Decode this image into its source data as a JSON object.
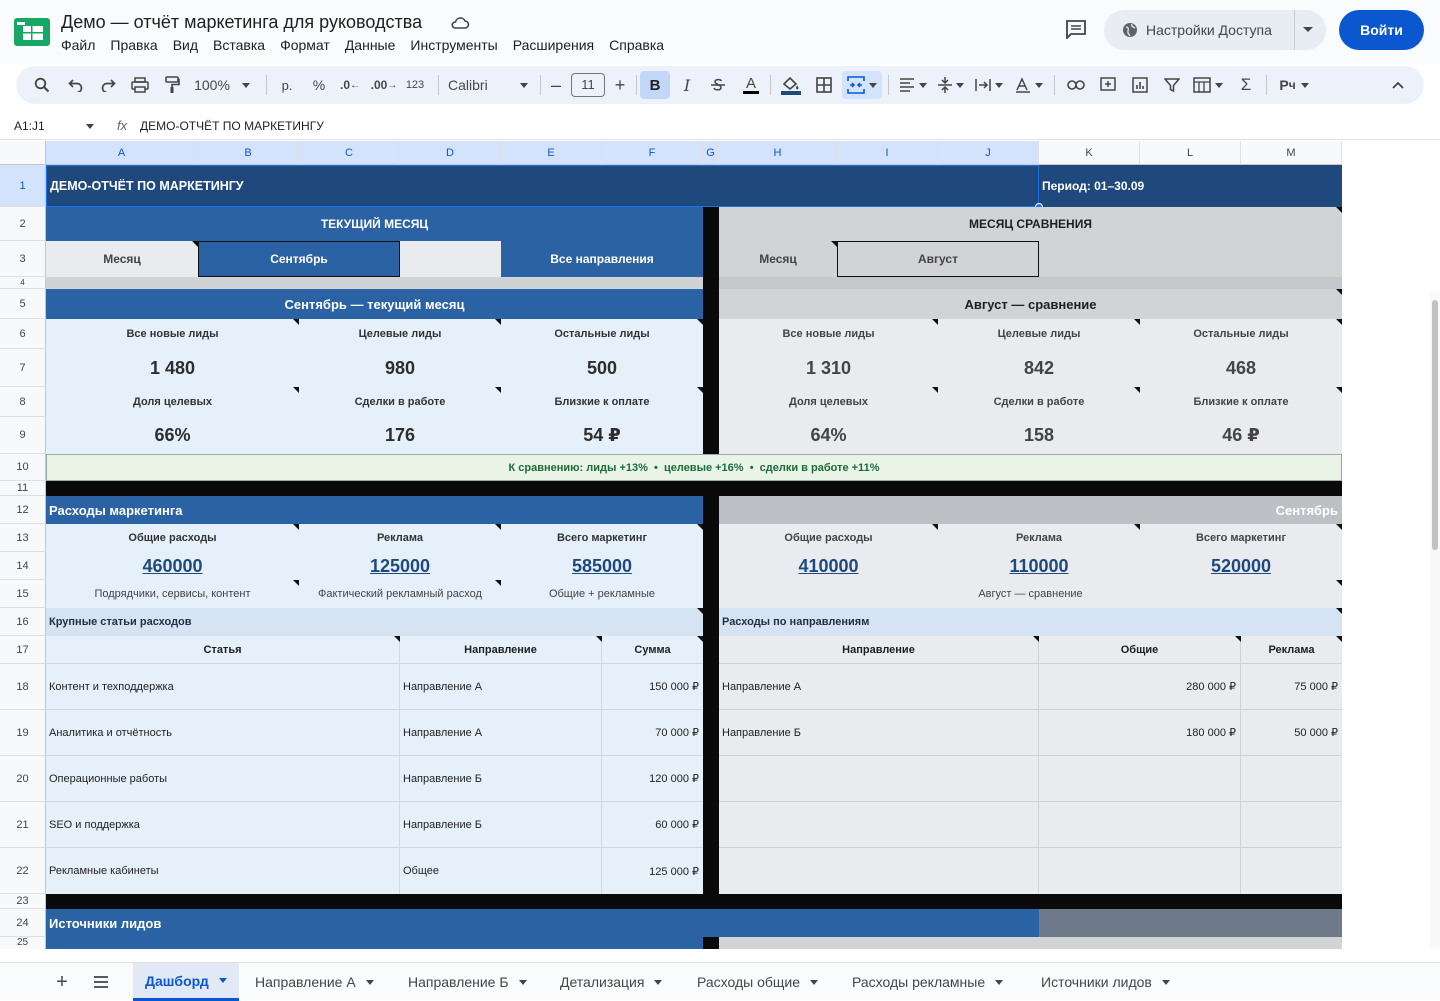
{
  "app": {
    "doc_title": "Демо — отчёт маркетинга для руководства",
    "menu": [
      "Файл",
      "Правка",
      "Вид",
      "Вставка",
      "Формат",
      "Данные",
      "Инструменты",
      "Расширения",
      "Справка"
    ],
    "access_label": "Настройки Доступа",
    "login_label": "Войти"
  },
  "toolbar": {
    "zoom": "100%",
    "currency": "р.",
    "percent": "%",
    "dec_less": ".0",
    "dec_more": ".00",
    "num_format": "123",
    "font": "Calibri",
    "font_size": "11",
    "bold": "B",
    "italic": "I",
    "text_color": "A"
  },
  "formula_bar": {
    "name_box": "A1:J1",
    "fx": "fx",
    "content": "ДЕМО-ОТЧЁТ ПО МАРКЕТИНГУ"
  },
  "columns": [
    "A",
    "B",
    "C",
    "D",
    "E",
    "F",
    "G",
    "H",
    "I",
    "J",
    "K",
    "L",
    "M"
  ],
  "rows": [
    "1",
    "2",
    "3",
    "4",
    "5",
    "6",
    "7",
    "8",
    "9",
    "10",
    "11",
    "12",
    "13",
    "14",
    "15",
    "16",
    "17",
    "18",
    "19",
    "20",
    "21",
    "22",
    "23",
    "24",
    "25"
  ],
  "report": {
    "title": "ДЕМО-ОТЧЁТ ПО МАРКЕТИНГУ",
    "period": "Период: 01–30.09",
    "current_header": "ТЕКУЩИЙ МЕСЯЦ",
    "compare_header": "МЕСЯЦ СРАВНЕНИЯ",
    "month_label": "Месяц",
    "current_month": "Сентябрь",
    "direction_filter": "Все направления",
    "compare_month_label": "Месяц",
    "compare_month": "Август",
    "current_block_title": "Сентябрь — текущий месяц",
    "compare_block_title": "Август — сравнение",
    "kpi_labels": [
      "Все новые лиды",
      "Целевые лиды",
      "Остальные лиды",
      "Доля целевых",
      "Сделки в работе",
      "Близкие к оплате"
    ],
    "current_kpis": [
      "1 480",
      "980",
      "500",
      "66%",
      "176",
      "54 ₽"
    ],
    "compare_kpis": [
      "1 310",
      "842",
      "468",
      "64%",
      "158",
      "46 ₽"
    ],
    "comparison_note": "К сравнению: лиды +13%  •  целевые +16%  •  сделки в работе +11%",
    "expenses_title": "Расходы маркетинга",
    "expenses_month": "Сентябрь",
    "expense_labels": [
      "Общие расходы",
      "Реклама",
      "Всего маркетинг"
    ],
    "current_expenses": [
      "460000",
      "125000",
      "585000"
    ],
    "current_expense_notes": [
      "Подрядчики, сервисы, контент",
      "Фактический рекламный расход",
      "Общие + рекламные"
    ],
    "compare_expenses": [
      "410000",
      "110000",
      "520000"
    ],
    "compare_expense_note": "Август — сравнение",
    "items_title": "Крупные статьи расходов",
    "items_headers": [
      "Статья",
      "Направление",
      "Сумма"
    ],
    "items": [
      {
        "name": "Контент и техподдержка",
        "dir": "Направление А",
        "sum": "150 000 ₽"
      },
      {
        "name": "Аналитика и отчётность",
        "dir": "Направление А",
        "sum": "70 000 ₽"
      },
      {
        "name": "Операционные работы",
        "dir": "Направление Б",
        "sum": "120 000 ₽"
      },
      {
        "name": "SEO и поддержка",
        "dir": "Направление Б",
        "sum": "60 000 ₽"
      },
      {
        "name": "Рекламные кабинеты",
        "dir": "Общее",
        "sum": "125 000 ₽"
      }
    ],
    "by_dir_title": "Расходы по направлениям",
    "by_dir_headers": [
      "Направление",
      "Общие",
      "Реклама"
    ],
    "by_dir": [
      {
        "dir": "Направление А",
        "general": "280 000 ₽",
        "ads": "75 000 ₽"
      },
      {
        "dir": "Направление Б",
        "general": "180 000 ₽",
        "ads": "50 000 ₽"
      }
    ],
    "sources_title": "Источники лидов"
  },
  "tabs": [
    "Дашборд",
    "Направление А",
    "Направление Б",
    "Детализация",
    "Расходы общие",
    "Расходы рекламные",
    "Источники лидов"
  ],
  "colors": {
    "navy": "#1f497d",
    "blue": "#2a62a4",
    "light_blue": "#e6f0fb",
    "grey": "#d2d3d5",
    "accent": "#0b57d0",
    "note_green": "#1e6b3a"
  }
}
